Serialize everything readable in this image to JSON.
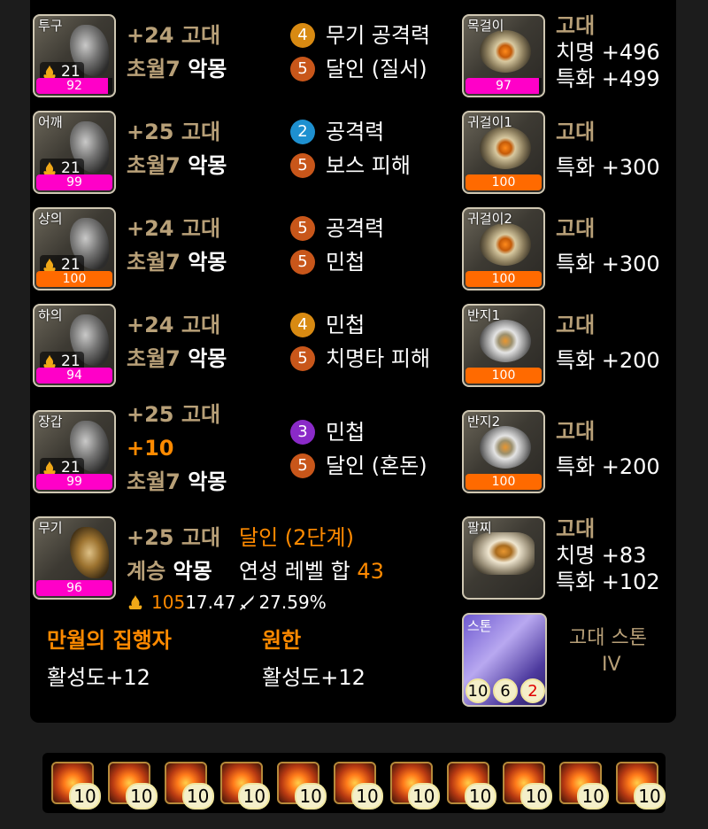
{
  "armor": [
    {
      "slot": "투구",
      "flame": "21",
      "quality": "92",
      "quality_pct": 92,
      "bar": "magenta",
      "line1": "+24 고대",
      "set": "초월7",
      "set_name": "악몽",
      "effects": [
        {
          "lvl": "4",
          "color": "c4",
          "text": "무기 공격력"
        },
        {
          "lvl": "5",
          "color": "c5",
          "text": "달인 (질서)"
        }
      ]
    },
    {
      "slot": "어깨",
      "flame": "21",
      "quality": "99",
      "quality_pct": 99,
      "bar": "magenta",
      "line1": "+25 고대",
      "set": "초월7",
      "set_name": "악몽",
      "effects": [
        {
          "lvl": "2",
          "color": "c2",
          "text": "공격력"
        },
        {
          "lvl": "5",
          "color": "c5",
          "text": "보스 피해"
        }
      ]
    },
    {
      "slot": "상의",
      "flame": "21",
      "quality": "100",
      "quality_pct": 100,
      "bar": "orange",
      "line1": "+24 고대",
      "set": "초월7",
      "set_name": "악몽",
      "effects": [
        {
          "lvl": "5",
          "color": "c5",
          "text": "공격력"
        },
        {
          "lvl": "5",
          "color": "c5",
          "text": "민첩"
        }
      ]
    },
    {
      "slot": "하의",
      "flame": "21",
      "quality": "94",
      "quality_pct": 94,
      "bar": "magenta",
      "line1": "+24 고대",
      "set": "초월7",
      "set_name": "악몽",
      "effects": [
        {
          "lvl": "4",
          "color": "c4",
          "text": "민첩"
        },
        {
          "lvl": "5",
          "color": "c5",
          "text": "치명타 피해"
        }
      ]
    },
    {
      "slot": "장갑",
      "flame": "21",
      "quality": "99",
      "quality_pct": 99,
      "bar": "magenta",
      "line1": "+25 고대",
      "extra": "+10",
      "set": "초월7",
      "set_name": "악몽",
      "effects": [
        {
          "lvl": "3",
          "color": "c3",
          "text": "민첩"
        },
        {
          "lvl": "5",
          "color": "c5",
          "text": "달인 (혼돈)"
        }
      ]
    }
  ],
  "weapon": {
    "slot": "무기",
    "quality": "96",
    "quality_pct": 96,
    "line1": "+25 고대",
    "master": "달인 (2단계)",
    "succession": "계승",
    "succession_name": "악몽",
    "elixir_label": "연성 레벨 합",
    "elixir_value": "43",
    "flame_value": "105",
    "stat1": "17.47",
    "stat2": "27.59%"
  },
  "set_bonus": [
    {
      "title": "만월의 집행자",
      "value": "활성도+12"
    },
    {
      "title": "원한",
      "value": "활성도+12"
    }
  ],
  "accessories": [
    {
      "slot": "목걸이",
      "quality": "97",
      "quality_pct": 97,
      "bar": "magenta",
      "grade": "고대",
      "stats": [
        "치명 +496",
        "특화 +499"
      ]
    },
    {
      "slot": "귀걸이1",
      "quality": "100",
      "quality_pct": 100,
      "bar": "orange",
      "grade": "고대",
      "stats": [
        "특화 +300"
      ]
    },
    {
      "slot": "귀걸이2",
      "quality": "100",
      "quality_pct": 100,
      "bar": "orange",
      "grade": "고대",
      "stats": [
        "특화 +300"
      ]
    },
    {
      "slot": "반지1",
      "quality": "100",
      "quality_pct": 100,
      "bar": "orange",
      "grade": "고대",
      "stats": [
        "특화 +200"
      ]
    },
    {
      "slot": "반지2",
      "quality": "100",
      "quality_pct": 100,
      "bar": "orange",
      "grade": "고대",
      "stats": [
        "특화 +200"
      ]
    },
    {
      "slot": "팔찌",
      "grade": "고대",
      "stats": [
        "치명 +83",
        "특화 +102"
      ]
    }
  ],
  "stone": {
    "slot": "스톤",
    "title_line1": "고대 스톤",
    "title_line2": "IV",
    "engrave": [
      "10",
      "6",
      "2"
    ]
  },
  "gems": [
    "10",
    "10",
    "10",
    "10",
    "10",
    "10",
    "10",
    "10",
    "10",
    "10",
    "10"
  ],
  "colors": {
    "magenta": "#ff00c8",
    "orange": "#ff6a00",
    "tan": "#b8a078",
    "accent": "#ff8a00"
  }
}
